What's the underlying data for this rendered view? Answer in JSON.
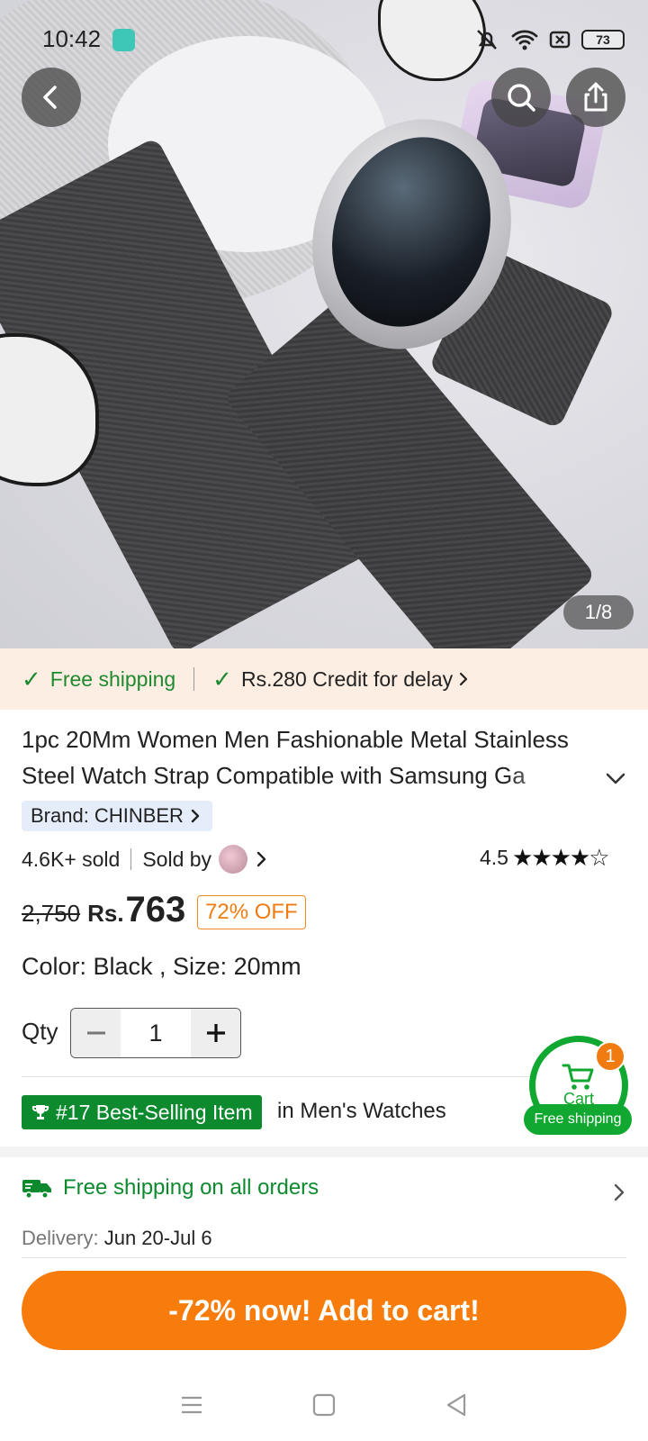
{
  "status_bar": {
    "time": "10:42",
    "battery": "73"
  },
  "gallery": {
    "counter": "1/8"
  },
  "shipping_banner": {
    "free_shipping": "Free shipping",
    "credit": "Rs.280 Credit for delay"
  },
  "product": {
    "title": "1pc 20Mm Women Men Fashionable Metal Stainless Steel Watch Strap Compatible with Samsung Ga",
    "brand": "Brand: CHINBER",
    "sold": "4.6K+ sold",
    "sold_by": "Sold by",
    "rating": "4.5",
    "old_price": "2,750",
    "currency": "Rs.",
    "price": "763",
    "discount": "72% OFF",
    "variant": "Color: Black , Size: 20mm"
  },
  "quantity": {
    "label": "Qty",
    "value": "1"
  },
  "best_selling": {
    "badge": "#17 Best-Selling Item",
    "category": "in Men's Watches"
  },
  "cart": {
    "label": "Cart",
    "count": "1",
    "free_shipping": "Free shipping"
  },
  "shipping_info": {
    "title": "Free shipping on all orders",
    "delivery_label": "Delivery:",
    "delivery_value": "Jun 20-Jul 6"
  },
  "cta": {
    "label": "-72% now! Add to cart!"
  },
  "colors": {
    "accent_orange": "#f77c0b",
    "green": "#0d8a2e",
    "banner_bg": "#fdeee3"
  }
}
